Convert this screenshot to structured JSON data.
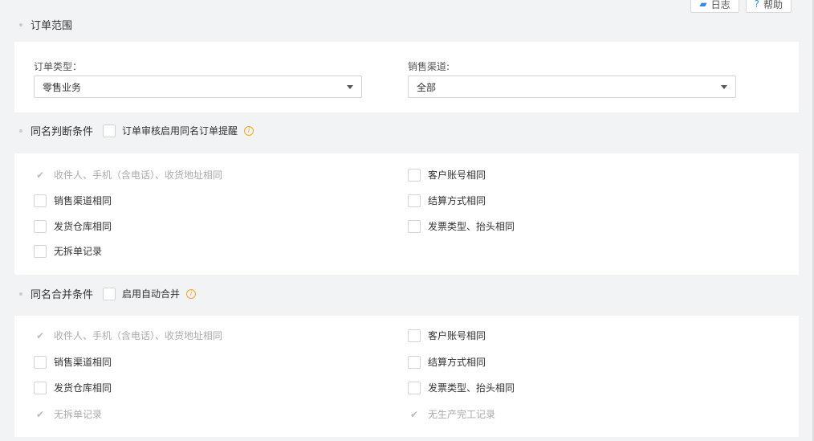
{
  "toolbar": {
    "log_label": "日志",
    "help_label": "帮助"
  },
  "order_scope": {
    "title": "订单范围",
    "type_label": "订单类型：",
    "type_value": "零售业务",
    "channel_label": "销售渠道:",
    "channel_value": "全部"
  },
  "same_name_check": {
    "title": "同名判断条件",
    "toggle_label": "订单审核启用同名订单提醒",
    "items": [
      {
        "label": "收件人、手机（含电话）、收货地址相同",
        "checked": true,
        "disabled": true
      },
      {
        "label": "客户账号相同",
        "checked": false,
        "disabled": false
      },
      {
        "label": "销售渠道相同",
        "checked": false,
        "disabled": false
      },
      {
        "label": "结算方式相同",
        "checked": false,
        "disabled": false
      },
      {
        "label": "发货仓库相同",
        "checked": false,
        "disabled": false
      },
      {
        "label": "发票类型、抬头相同",
        "checked": false,
        "disabled": false
      },
      {
        "label": "无拆单记录",
        "checked": false,
        "disabled": false
      }
    ]
  },
  "same_name_merge": {
    "title": "同名合并条件",
    "toggle_label": "启用自动合并",
    "items": [
      {
        "label": "收件人、手机（含电话）、收货地址相同",
        "checked": true,
        "disabled": true
      },
      {
        "label": "客户账号相同",
        "checked": false,
        "disabled": false
      },
      {
        "label": "销售渠道相同",
        "checked": false,
        "disabled": false
      },
      {
        "label": "结算方式相同",
        "checked": false,
        "disabled": false
      },
      {
        "label": "发货仓库相同",
        "checked": false,
        "disabled": false
      },
      {
        "label": "发票类型、抬头相同",
        "checked": false,
        "disabled": false
      },
      {
        "label": "无拆单记录",
        "checked": true,
        "disabled": true
      },
      {
        "label": "无生产完工记录",
        "checked": true,
        "disabled": true
      }
    ]
  },
  "colors": {
    "accent": "#2d8cf0",
    "info": "#f5a623",
    "background": "#f2f3f5"
  }
}
